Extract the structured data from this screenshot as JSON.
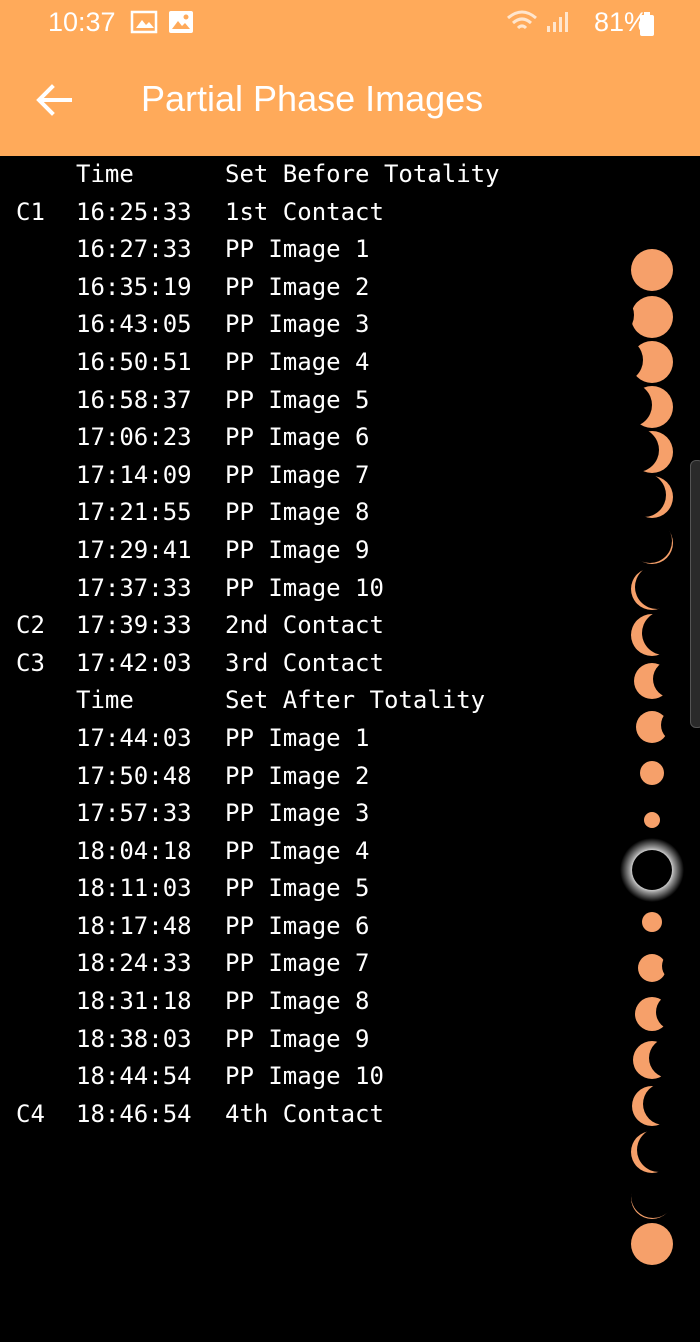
{
  "status": {
    "time": "10:37",
    "battery": "81%",
    "icons": [
      "gallery-icon",
      "image-icon",
      "wifi-icon",
      "signal-icon",
      "battery-icon"
    ]
  },
  "toolbar": {
    "title": "Partial Phase Images",
    "back_icon": "back-arrow-icon"
  },
  "colors": {
    "bar": "#FFAA5A",
    "background": "#000000",
    "sun": "#F6A06A"
  },
  "rows": [
    {
      "code": "",
      "time": "Time",
      "label": "Set Before Totality"
    },
    {
      "code": "C1",
      "time": "16:25:33",
      "label": "1st Contact"
    },
    {
      "code": "",
      "time": "16:27:33",
      "label": "PP Image 1"
    },
    {
      "code": "",
      "time": "16:35:19",
      "label": "PP Image 2"
    },
    {
      "code": "",
      "time": "16:43:05",
      "label": "PP Image 3"
    },
    {
      "code": "",
      "time": "16:50:51",
      "label": "PP Image 4"
    },
    {
      "code": "",
      "time": "16:58:37",
      "label": "PP Image 5"
    },
    {
      "code": "",
      "time": "17:06:23",
      "label": "PP Image 6"
    },
    {
      "code": "",
      "time": "17:14:09",
      "label": "PP Image 7"
    },
    {
      "code": "",
      "time": "17:21:55",
      "label": "PP Image 8"
    },
    {
      "code": "",
      "time": "17:29:41",
      "label": "PP Image 9"
    },
    {
      "code": "",
      "time": "17:37:33",
      "label": "PP Image 10"
    },
    {
      "code": "C2",
      "time": "17:39:33",
      "label": "2nd Contact"
    },
    {
      "code": "C3",
      "time": "17:42:03",
      "label": "3rd Contact"
    },
    {
      "code": "",
      "time": "Time",
      "label": "Set After Totality"
    },
    {
      "code": "",
      "time": "17:44:03",
      "label": "PP Image 1"
    },
    {
      "code": "",
      "time": "17:50:48",
      "label": "PP Image 2"
    },
    {
      "code": "",
      "time": "17:57:33",
      "label": "PP Image 3"
    },
    {
      "code": "",
      "time": "18:04:18",
      "label": "PP Image 4"
    },
    {
      "code": "",
      "time": "18:11:03",
      "label": "PP Image 5"
    },
    {
      "code": "",
      "time": "18:17:48",
      "label": "PP Image 6"
    },
    {
      "code": "",
      "time": "18:24:33",
      "label": "PP Image 7"
    },
    {
      "code": "",
      "time": "18:31:18",
      "label": "PP Image 8"
    },
    {
      "code": "",
      "time": "18:38:03",
      "label": "PP Image 9"
    },
    {
      "code": "",
      "time": "18:44:54",
      "label": "PP Image 10"
    },
    {
      "code": "C4",
      "time": "18:46:54",
      "label": "4th Contact"
    }
  ]
}
